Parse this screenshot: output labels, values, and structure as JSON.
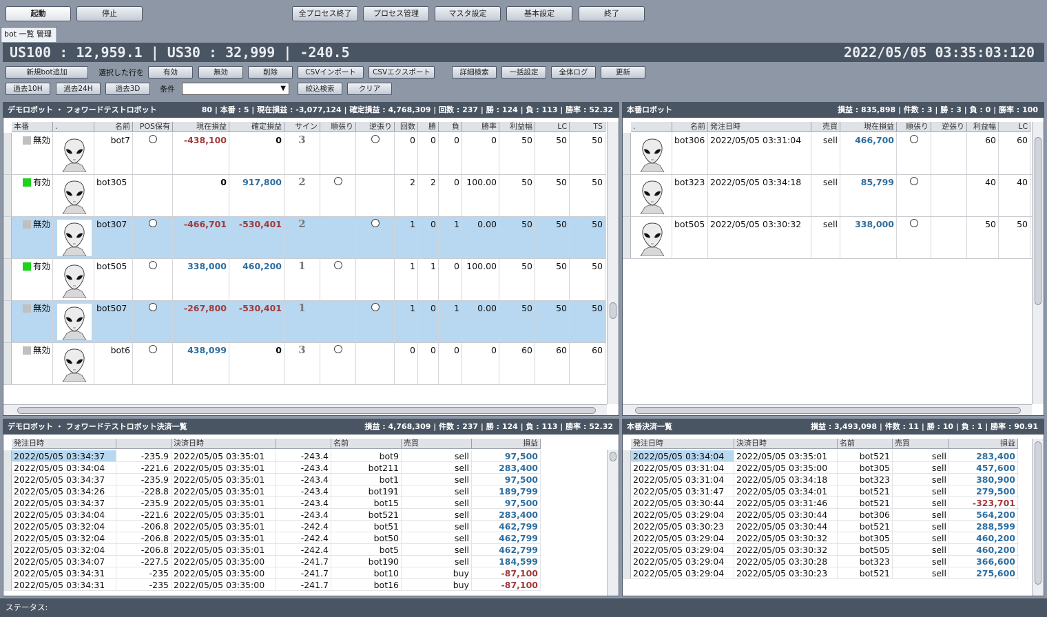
{
  "toolbar": {
    "start": "起動",
    "stop": "停止",
    "endall": "全プロセス終了",
    "proc": "プロセス管理",
    "master": "マスタ設定",
    "basic": "基本設定",
    "exit": "終了"
  },
  "tab": "bot 一覧 管理",
  "quote": {
    "text": "US100 : 12,959.1 | US30 : 32,999 | -240.5",
    "time": "2022/05/05 03:35:03:120"
  },
  "actions": {
    "add": "新規bot追加",
    "selected_label": "選択した行を",
    "enable": "有効",
    "disable": "無効",
    "delete": "削除",
    "csv_import": "CSVインポート",
    "csv_export": "CSVエクスポート",
    "detail_search": "詳細検索",
    "bulk": "一括設定",
    "all_log": "全体ログ",
    "refresh": "更新",
    "past10h": "過去10H",
    "past24h": "過去24H",
    "past3d": "過去3D",
    "cond_label": "条件",
    "filter": "絞込検索",
    "clear": "クリア"
  },
  "demo": {
    "title": "デモロボット ・ フォワードテストロボット",
    "summary": "80 | 本番 : 5 | 現在損益 : -3,077,124 | 確定損益 : 4,768,309 | 回数 : 237 | 勝 : 124 | 負 : 113 | 勝率 : 52.32",
    "headers": [
      "本番",
      ".",
      "名前",
      "POS保有",
      "現在損益",
      "確定損益",
      "サイン",
      "順張り",
      "逆張り",
      "回数",
      "勝",
      "負",
      "勝率",
      "利益幅",
      "LC",
      "TS"
    ],
    "rows": [
      {
        "status": "無効",
        "on": false,
        "name": "bot7",
        "pos": true,
        "cur": "-438,100",
        "cur_t": "neg",
        "fix": "0",
        "fix_t": "zero",
        "sign": "3",
        "jun": false,
        "gyaku": true,
        "count": "0",
        "win": "0",
        "lose": "0",
        "rate": "0",
        "profit": "50",
        "lc": "50",
        "ts": "50",
        "sel": false
      },
      {
        "status": "有効",
        "on": true,
        "name": "bot305",
        "pos": false,
        "cur": "0",
        "cur_t": "zero",
        "fix": "917,800",
        "fix_t": "pos",
        "sign": "2",
        "jun": true,
        "gyaku": false,
        "count": "2",
        "win": "2",
        "lose": "0",
        "rate": "100.00",
        "profit": "50",
        "lc": "50",
        "ts": "50",
        "sel": false
      },
      {
        "status": "無効",
        "on": false,
        "name": "bot307",
        "pos": true,
        "cur": "-466,701",
        "cur_t": "neg",
        "fix": "-530,401",
        "fix_t": "neg",
        "sign": "2",
        "jun": false,
        "gyaku": true,
        "count": "1",
        "win": "0",
        "lose": "1",
        "rate": "0.00",
        "profit": "50",
        "lc": "50",
        "ts": "50",
        "sel": true
      },
      {
        "status": "有効",
        "on": true,
        "name": "bot505",
        "pos": true,
        "cur": "338,000",
        "cur_t": "pos",
        "fix": "460,200",
        "fix_t": "pos",
        "sign": "1",
        "jun": true,
        "gyaku": false,
        "count": "1",
        "win": "1",
        "lose": "0",
        "rate": "100.00",
        "profit": "50",
        "lc": "50",
        "ts": "50",
        "sel": false
      },
      {
        "status": "無効",
        "on": false,
        "name": "bot507",
        "pos": true,
        "cur": "-267,800",
        "cur_t": "neg",
        "fix": "-530,401",
        "fix_t": "neg",
        "sign": "1",
        "jun": false,
        "gyaku": true,
        "count": "1",
        "win": "0",
        "lose": "1",
        "rate": "0.00",
        "profit": "50",
        "lc": "50",
        "ts": "50",
        "sel": true
      },
      {
        "status": "無効",
        "on": false,
        "name": "bot6",
        "pos": true,
        "cur": "438,099",
        "cur_t": "pos",
        "fix": "0",
        "fix_t": "zero",
        "sign": "3",
        "jun": true,
        "gyaku": false,
        "count": "0",
        "win": "0",
        "lose": "0",
        "rate": "0",
        "profit": "60",
        "lc": "60",
        "ts": "60",
        "sel": false
      }
    ]
  },
  "prod": {
    "title": "本番ロボット",
    "summary": "損益 : 835,898 | 件数 : 3 | 勝 : 3 | 負 : 0 | 勝率 : 100",
    "headers": [
      ".",
      "名前",
      "発注日時",
      "売買",
      "現在損益",
      "順張り",
      "逆張り",
      "利益幅",
      "LC"
    ],
    "rows": [
      {
        "name": "bot306",
        "date": "2022/05/05 03:31:04",
        "side": "sell",
        "cur": "466,700",
        "jun": true,
        "profit": "60",
        "lc": "60"
      },
      {
        "name": "bot323",
        "date": "2022/05/05 03:34:18",
        "side": "sell",
        "cur": "85,799",
        "jun": true,
        "profit": "40",
        "lc": "40"
      },
      {
        "name": "bot505",
        "date": "2022/05/05 03:30:32",
        "side": "sell",
        "cur": "338,000",
        "jun": true,
        "profit": "50",
        "lc": "50"
      }
    ]
  },
  "demo_settle": {
    "title": "デモロボット ・ フォワードテストロボット決済一覧",
    "summary": "損益 : 4,768,309 | 件数 : 237 | 勝 : 124 | 負 : 113 | 勝率 : 52.32",
    "headers": [
      "発注日時",
      "",
      "決済日時",
      "",
      "名前",
      "売買",
      "損益"
    ],
    "rows": [
      [
        "2022/05/05 03:34:37",
        "-235.9",
        "2022/05/05 03:35:01",
        "-243.4",
        "bot9",
        "sell",
        "97,500"
      ],
      [
        "2022/05/05 03:34:04",
        "-221.6",
        "2022/05/05 03:35:01",
        "-243.4",
        "bot211",
        "sell",
        "283,400"
      ],
      [
        "2022/05/05 03:34:37",
        "-235.9",
        "2022/05/05 03:35:01",
        "-243.4",
        "bot1",
        "sell",
        "97,500"
      ],
      [
        "2022/05/05 03:34:26",
        "-228.8",
        "2022/05/05 03:35:01",
        "-243.4",
        "bot191",
        "sell",
        "189,799"
      ],
      [
        "2022/05/05 03:34:37",
        "-235.9",
        "2022/05/05 03:35:01",
        "-243.4",
        "bot15",
        "sell",
        "97,500"
      ],
      [
        "2022/05/05 03:34:04",
        "-221.6",
        "2022/05/05 03:35:01",
        "-243.4",
        "bot521",
        "sell",
        "283,400"
      ],
      [
        "2022/05/05 03:32:04",
        "-206.8",
        "2022/05/05 03:35:01",
        "-242.4",
        "bot51",
        "sell",
        "462,799"
      ],
      [
        "2022/05/05 03:32:04",
        "-206.8",
        "2022/05/05 03:35:01",
        "-242.4",
        "bot50",
        "sell",
        "462,799"
      ],
      [
        "2022/05/05 03:32:04",
        "-206.8",
        "2022/05/05 03:35:01",
        "-242.4",
        "bot5",
        "sell",
        "462,799"
      ],
      [
        "2022/05/05 03:34:07",
        "-227.5",
        "2022/05/05 03:35:00",
        "-241.7",
        "bot190",
        "sell",
        "184,599"
      ],
      [
        "2022/05/05 03:34:31",
        "-235",
        "2022/05/05 03:35:00",
        "-241.7",
        "bot10",
        "buy",
        "-87,100"
      ],
      [
        "2022/05/05 03:34:31",
        "-235",
        "2022/05/05 03:35:00",
        "-241.7",
        "bot16",
        "buy",
        "-87,100"
      ]
    ]
  },
  "prod_settle": {
    "title": "本番決済一覧",
    "summary": "損益 : 3,493,098 | 件数 : 11 | 勝 : 10 | 負 : 1 | 勝率 : 90.91",
    "headers": [
      "発注日時",
      "決済日時",
      "名前",
      "売買",
      "損益"
    ],
    "rows": [
      [
        "2022/05/05 03:34:04",
        "2022/05/05 03:35:01",
        "bot521",
        "sell",
        "283,400"
      ],
      [
        "2022/05/05 03:31:04",
        "2022/05/05 03:35:00",
        "bot305",
        "sell",
        "457,600"
      ],
      [
        "2022/05/05 03:31:04",
        "2022/05/05 03:34:18",
        "bot323",
        "sell",
        "380,900"
      ],
      [
        "2022/05/05 03:31:47",
        "2022/05/05 03:34:01",
        "bot521",
        "sell",
        "279,500"
      ],
      [
        "2022/05/05 03:30:44",
        "2022/05/05 03:31:46",
        "bot521",
        "sell",
        "-323,701"
      ],
      [
        "2022/05/05 03:29:04",
        "2022/05/05 03:30:44",
        "bot306",
        "sell",
        "564,200"
      ],
      [
        "2022/05/05 03:30:23",
        "2022/05/05 03:30:44",
        "bot521",
        "sell",
        "288,599"
      ],
      [
        "2022/05/05 03:29:04",
        "2022/05/05 03:30:32",
        "bot305",
        "sell",
        "460,200"
      ],
      [
        "2022/05/05 03:29:04",
        "2022/05/05 03:30:32",
        "bot505",
        "sell",
        "460,200"
      ],
      [
        "2022/05/05 03:29:04",
        "2022/05/05 03:30:28",
        "bot323",
        "sell",
        "366,600"
      ],
      [
        "2022/05/05 03:29:04",
        "2022/05/05 03:30:23",
        "bot521",
        "sell",
        "275,600"
      ]
    ]
  },
  "status": "ステータス:"
}
